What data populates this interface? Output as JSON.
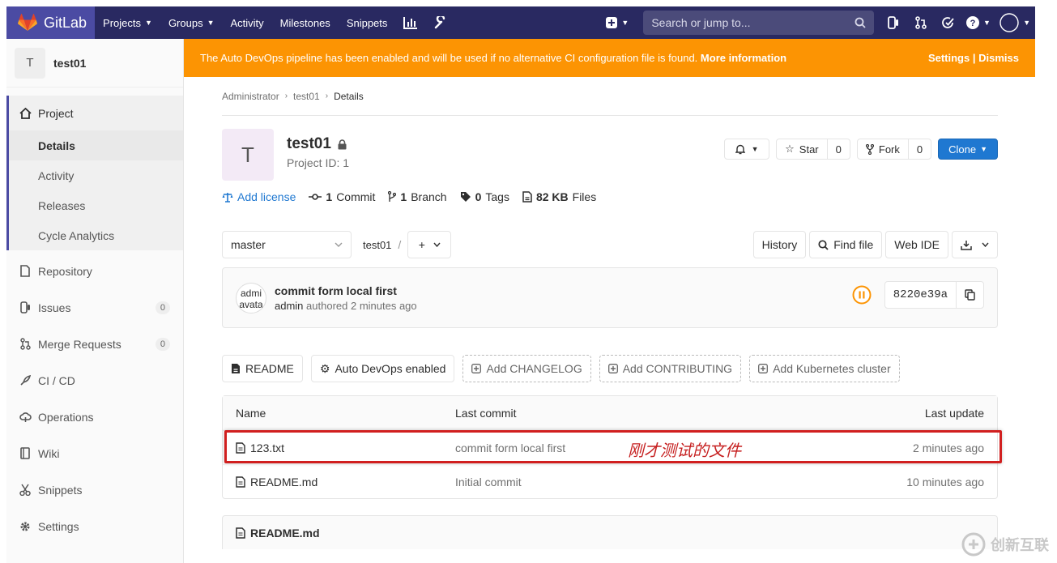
{
  "topbar": {
    "brand": "GitLab",
    "nav": [
      "Projects",
      "Groups",
      "Activity",
      "Milestones",
      "Snippets"
    ],
    "search_placeholder": "Search or jump to..."
  },
  "sidebar": {
    "project_initial": "T",
    "project_name": "test01",
    "project_label": "Project",
    "sub_items": [
      "Details",
      "Activity",
      "Releases",
      "Cycle Analytics"
    ],
    "repository": "Repository",
    "issues": "Issues",
    "issues_count": "0",
    "merge_requests": "Merge Requests",
    "merge_requests_count": "0",
    "cicd": "CI / CD",
    "operations": "Operations",
    "wiki": "Wiki",
    "snippets": "Snippets",
    "settings": "Settings"
  },
  "banner": {
    "text": "The Auto DevOps pipeline has been enabled and will be used if no alternative CI configuration file is found.",
    "link": "More information",
    "settings": "Settings",
    "sep": "|",
    "dismiss": "Dismiss",
    "color": "#fc9403"
  },
  "breadcrumb": [
    "Administrator",
    "test01",
    "Details"
  ],
  "project": {
    "initial": "T",
    "name": "test01",
    "id_text": "Project ID: 1",
    "star_label": "Star",
    "star_count": "0",
    "fork_label": "Fork",
    "fork_count": "0",
    "clone_label": "Clone"
  },
  "stats": {
    "add_license": "Add license",
    "commit_n": "1",
    "commit_label": "Commit",
    "branch_n": "1",
    "branch_label": "Branch",
    "tags_n": "0",
    "tags_label": "Tags",
    "files_n": "82 KB",
    "files_label": "Files"
  },
  "toolbar": {
    "branch": "master",
    "path": "test01",
    "path_sep": "/",
    "history": "History",
    "find_file": "Find file",
    "web_ide": "Web IDE"
  },
  "commit": {
    "avatar_alt_1": "admi",
    "avatar_alt_2": "avata",
    "title": "commit form local first",
    "author": "admin",
    "meta": "authored 2 minutes ago",
    "sha": "8220e39a"
  },
  "quick_buttons": {
    "readme": "README",
    "autodevops": "Auto DevOps enabled",
    "changelog": "Add CHANGELOG",
    "contributing": "Add CONTRIBUTING",
    "k8s": "Add Kubernetes cluster"
  },
  "tree": {
    "headers": {
      "name": "Name",
      "last_commit": "Last commit",
      "last_update": "Last update"
    },
    "rows": [
      {
        "name": "123.txt",
        "commit": "commit form local first",
        "updated": "2 minutes ago"
      },
      {
        "name": "README.md",
        "commit": "Initial commit",
        "updated": "10 minutes ago"
      }
    ],
    "annotation": "刚才测试的文件"
  },
  "readme_title": "README.md",
  "watermark": "创新互联"
}
